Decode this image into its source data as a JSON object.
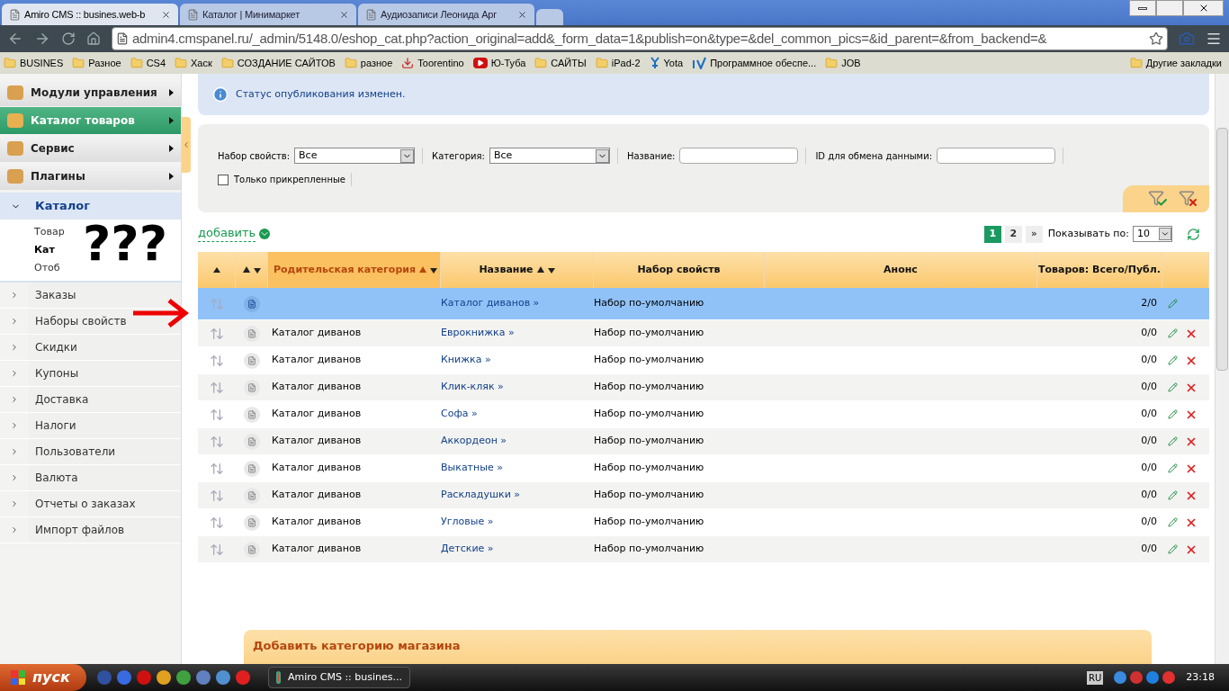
{
  "browser": {
    "tabs": [
      {
        "title": "Amiro CMS :: busines.web-b",
        "selected": true
      },
      {
        "title": "Каталог | Минимаркет",
        "selected": false
      },
      {
        "title": "Аудиозаписи Леонида Арг",
        "selected": false
      }
    ],
    "url": "admin4.cmspanel.ru/_admin/5148.0/eshop_cat.php?action_original=add&_form_data=1&publish=on&type=&del_common_pics=&id_parent=&from_backend=&",
    "bookmarks": [
      {
        "label": "BUSINES",
        "kind": "folder"
      },
      {
        "label": "Разное",
        "kind": "folder"
      },
      {
        "label": "CS4",
        "kind": "folder"
      },
      {
        "label": "Хаск",
        "kind": "folder"
      },
      {
        "label": "СОЗДАНИЕ САЙТОВ",
        "kind": "folder"
      },
      {
        "label": "разное",
        "kind": "folder"
      },
      {
        "label": "Toorentino",
        "kind": "download"
      },
      {
        "label": "Ю-Туба",
        "kind": "video"
      },
      {
        "label": "САЙТЫ",
        "kind": "folder"
      },
      {
        "label": "iPad-2",
        "kind": "folder"
      },
      {
        "label": "Yota",
        "kind": "yota"
      },
      {
        "label": "Программное обеспе...",
        "kind": "iv"
      },
      {
        "label": "JOB",
        "kind": "folder"
      }
    ],
    "other_bookmarks": "Другие закладки"
  },
  "sidebar": {
    "modules": [
      {
        "label": "Модули управления",
        "selected": false
      },
      {
        "label": "Каталог товаров",
        "selected": true
      },
      {
        "label": "Сервис",
        "selected": false
      },
      {
        "label": "Плагины",
        "selected": false
      }
    ],
    "section": {
      "label": "Каталог",
      "expanded": true,
      "children": [
        {
          "label": "Товар",
          "selected": false
        },
        {
          "label": "Кат",
          "selected": true
        },
        {
          "label": "Отоб",
          "selected": false
        }
      ]
    },
    "items": [
      "Заказы",
      "Наборы свойств",
      "Скидки",
      "Купоны",
      "Доставка",
      "Налоги",
      "Пользователи",
      "Валюта",
      "Отчеты о заказах",
      "Импорт файлов"
    ]
  },
  "annotation": "???",
  "notice": "Статус опубликования изменен.",
  "filters": {
    "fields": [
      {
        "kind": "select",
        "label": "Набор свойств:",
        "value": "Все"
      },
      {
        "kind": "select",
        "label": "Категория:",
        "value": "Все"
      },
      {
        "kind": "text",
        "label": "Название:"
      },
      {
        "kind": "text",
        "label": "ID для обмена данными:"
      }
    ],
    "pinned": {
      "label": "Только прикрепленные",
      "checked": false
    }
  },
  "add_link": "добавить",
  "pagination": {
    "pages": [
      {
        "label": "1",
        "selected": true
      },
      {
        "label": "2",
        "selected": false
      }
    ],
    "next": "»",
    "per_page_label": "Показывать по:",
    "per_page": "10"
  },
  "table": {
    "columns": [
      {
        "kind": "up",
        "selected": false
      },
      {
        "kind": "both",
        "selected": false
      },
      {
        "label": "Родительская категория",
        "kind": "both",
        "selected": true
      },
      {
        "label": "Название",
        "kind": "both",
        "selected": false
      },
      {
        "label": "Набор свойств",
        "kind": "plain",
        "selected": false
      },
      {
        "label": "Анонс",
        "kind": "plain",
        "selected": false
      },
      {
        "label": "Товаров: Всего/Публ.",
        "kind": "plain",
        "selected": false
      },
      {
        "kind": "plain",
        "selected": false
      }
    ],
    "rows": [
      {
        "parent": "",
        "name": "Каталог диванов »",
        "set": "Набор по-умолчанию",
        "count": "2/0",
        "selected": true,
        "deletable": false
      },
      {
        "parent": "Каталог диванов",
        "name": "Еврокнижка »",
        "set": "Набор по-умолчанию",
        "count": "0/0",
        "selected": false,
        "deletable": true
      },
      {
        "parent": "Каталог диванов",
        "name": "Книжка »",
        "set": "Набор по-умолчанию",
        "count": "0/0",
        "selected": false,
        "deletable": true
      },
      {
        "parent": "Каталог диванов",
        "name": "Клик-кляк »",
        "set": "Набор по-умолчанию",
        "count": "0/0",
        "selected": false,
        "deletable": true
      },
      {
        "parent": "Каталог диванов",
        "name": "Софа »",
        "set": "Набор по-умолчанию",
        "count": "0/0",
        "selected": false,
        "deletable": true
      },
      {
        "parent": "Каталог диванов",
        "name": "Аккордеон »",
        "set": "Набор по-умолчанию",
        "count": "0/0",
        "selected": false,
        "deletable": true
      },
      {
        "parent": "Каталог диванов",
        "name": "Выкатные »",
        "set": "Набор по-умолчанию",
        "count": "0/0",
        "selected": false,
        "deletable": true
      },
      {
        "parent": "Каталог диванов",
        "name": "Раскладушки »",
        "set": "Набор по-умолчанию",
        "count": "0/0",
        "selected": false,
        "deletable": true
      },
      {
        "parent": "Каталог диванов",
        "name": "Угловые »",
        "set": "Набор по-умолчанию",
        "count": "0/0",
        "selected": false,
        "deletable": true
      },
      {
        "parent": "Каталог диванов",
        "name": "Детские »",
        "set": "Набор по-умолчанию",
        "count": "0/0",
        "selected": false,
        "deletable": true
      }
    ]
  },
  "add_panel": "Добавить категорию магазина",
  "taskbar": {
    "start": "пуск",
    "task": "Amiro CMS :: busines...",
    "lang": "RU",
    "clock": "23:18"
  }
}
